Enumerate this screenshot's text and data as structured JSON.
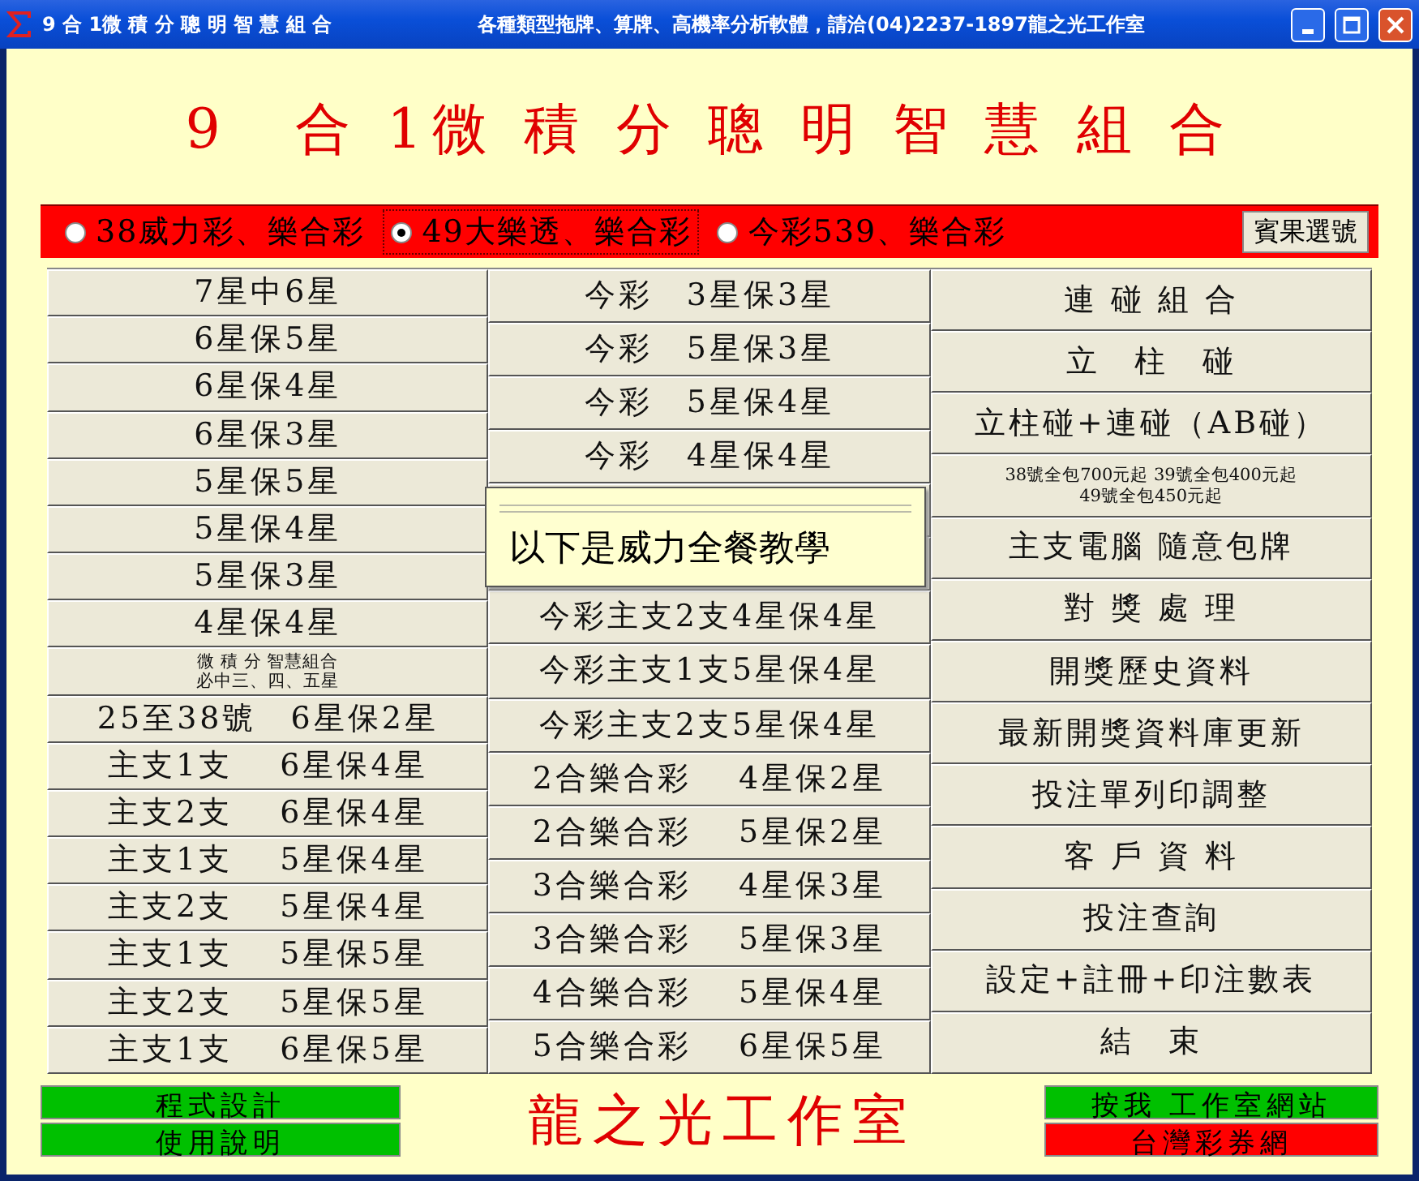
{
  "window": {
    "title": "9 合 1微 積 分 聰 明 智 慧 組 合",
    "subtitle": "各種類型拖牌、算牌、高機率分析軟體，請洽(04)2237-1897龍之光工作室"
  },
  "heading": "9　合 1微 積 分 聰 明 智 慧 組 合",
  "game_options": [
    {
      "label": "38威力彩、樂合彩",
      "selected": false
    },
    {
      "label": "49大樂透、樂合彩",
      "selected": true
    },
    {
      "label": "今彩539、樂合彩",
      "selected": false
    }
  ],
  "random_pick_button": "賓果選號",
  "columns": [
    [
      {
        "kind": "plain",
        "label": "7星中6星"
      },
      {
        "kind": "plain",
        "label": "6星保5星"
      },
      {
        "kind": "plain",
        "label": "6星保4星"
      },
      {
        "kind": "plain",
        "label": "6星保3星"
      },
      {
        "kind": "plain",
        "label": "5星保5星"
      },
      {
        "kind": "plain",
        "label": "5星保4星"
      },
      {
        "kind": "plain",
        "label": "5星保3星"
      },
      {
        "kind": "plain",
        "label": "4星保4星"
      },
      {
        "kind": "two-line",
        "lines": [
          "微 積 分 智慧組合",
          "必中三、四、五星"
        ]
      },
      {
        "kind": "plain",
        "label": "25至38號　6星保2星"
      },
      {
        "kind": "plain",
        "label": "主支1支　 6星保4星"
      },
      {
        "kind": "plain",
        "label": "主支2支　 6星保4星"
      },
      {
        "kind": "plain",
        "label": "主支1支　 5星保4星"
      },
      {
        "kind": "plain",
        "label": "主支2支　 5星保4星"
      },
      {
        "kind": "plain",
        "label": "主支1支　 5星保5星"
      },
      {
        "kind": "plain",
        "label": "主支2支　 5星保5星"
      },
      {
        "kind": "plain",
        "label": "主支1支　 6星保5星"
      }
    ],
    [
      {
        "kind": "plain",
        "label": "今彩　3星保3星"
      },
      {
        "kind": "plain",
        "label": "今彩　5星保3星"
      },
      {
        "kind": "plain",
        "label": "今彩　5星保4星"
      },
      {
        "kind": "plain",
        "label": "今彩　4星保4星"
      },
      {
        "kind": "plain"
      },
      {
        "kind": "plain"
      },
      {
        "kind": "plain",
        "label": "今彩主支2支4星保4星"
      },
      {
        "kind": "plain",
        "label": "今彩主支1支5星保4星"
      },
      {
        "kind": "plain",
        "label": "今彩主支2支5星保4星"
      },
      {
        "kind": "plain",
        "label": "2合樂合彩　 4星保2星"
      },
      {
        "kind": "plain",
        "label": "2合樂合彩　 5星保2星"
      },
      {
        "kind": "plain",
        "label": "3合樂合彩　 4星保3星"
      },
      {
        "kind": "plain",
        "label": "3合樂合彩　 5星保3星"
      },
      {
        "kind": "plain",
        "label": "4合樂合彩　 5星保4星"
      },
      {
        "kind": "plain",
        "label": "5合樂合彩　 6星保5星"
      }
    ],
    [
      {
        "kind": "plain",
        "label": "連 碰 組 合"
      },
      {
        "kind": "plain",
        "label": "立　柱　碰"
      },
      {
        "kind": "plain",
        "label": "立柱碰+連碰（AB碰）"
      },
      {
        "kind": "two-line",
        "lines": [
          "38號全包700元起 39號全包400元起",
          "49號全包450元起"
        ]
      },
      {
        "kind": "plain",
        "label": "主支電腦 隨意包牌"
      },
      {
        "kind": "plain",
        "label": "對 獎 處 理"
      },
      {
        "kind": "plain",
        "label": "開獎歷史資料"
      },
      {
        "kind": "plain",
        "label": "最新開獎資料庫更新"
      },
      {
        "kind": "plain",
        "label": "投注單列印調整"
      },
      {
        "kind": "plain",
        "label": "客 戶 資 料"
      },
      {
        "kind": "plain",
        "label": "投注查詢"
      },
      {
        "kind": "plain",
        "label": "設定+註冊+印注數表"
      },
      {
        "kind": "plain",
        "label": "結　束"
      }
    ]
  ],
  "tooltip": {
    "text": "以下是威力全餐教學"
  },
  "left_buttons": [
    {
      "label": "程式設計",
      "color": "#00c000"
    },
    {
      "label": "使用說明",
      "color": "#00c000"
    }
  ],
  "studio_name": "龍之光工作室",
  "right_buttons": [
    {
      "label": "按我 工作室網站",
      "color": "#00c000"
    },
    {
      "label": "台灣彩券網",
      "color": "#ff0000"
    }
  ]
}
